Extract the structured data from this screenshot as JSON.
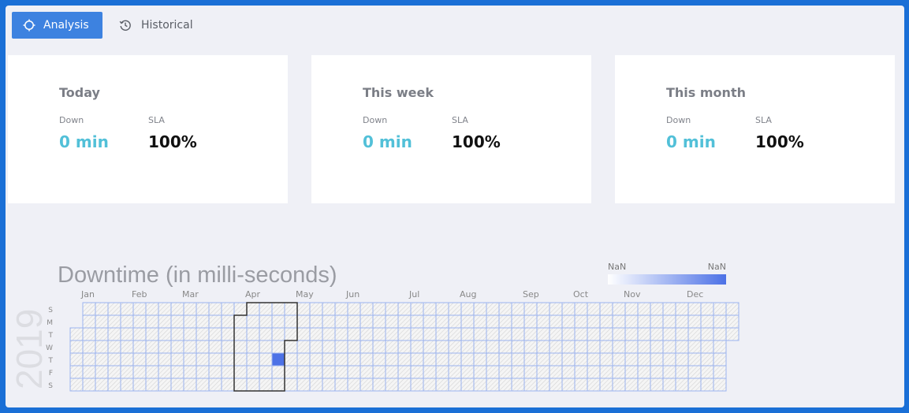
{
  "tabs": [
    {
      "label": "Analysis",
      "icon": "crosshair-icon",
      "active": true
    },
    {
      "label": "Historical",
      "icon": "history-icon",
      "active": false
    }
  ],
  "cards": [
    {
      "title": "Today",
      "down_label": "Down",
      "down_value": "0 min",
      "sla_label": "SLA",
      "sla_value": "100%"
    },
    {
      "title": "This week",
      "down_label": "Down",
      "down_value": "0 min",
      "sla_label": "SLA",
      "sla_value": "100%"
    },
    {
      "title": "This month",
      "down_label": "Down",
      "down_value": "0 min",
      "sla_label": "SLA",
      "sla_value": "100%"
    }
  ],
  "colors": {
    "accent": "#3d82e0",
    "down_value": "#52c0d8",
    "heat_low": "#ffffff",
    "heat_high": "#4c71e6",
    "grid_line": "#9bb3f0",
    "cell_hatch": "#d0d0d0"
  },
  "chart_data": {
    "type": "heatmap",
    "title": "Downtime (in milli-seconds)",
    "year": "2019",
    "months": [
      "Jan",
      "Feb",
      "Mar",
      "Apr",
      "May",
      "Jun",
      "Jul",
      "Aug",
      "Sep",
      "Oct",
      "Nov",
      "Dec"
    ],
    "weekdays": [
      "S",
      "M",
      "T",
      "W",
      "T",
      "F",
      "S"
    ],
    "legend": {
      "min_label": "NaN",
      "max_label": "NaN"
    },
    "highlighted_month": "Apr",
    "filled_days": [
      {
        "date": "2019-04-25",
        "level": 1
      }
    ],
    "other_days": "no data"
  }
}
